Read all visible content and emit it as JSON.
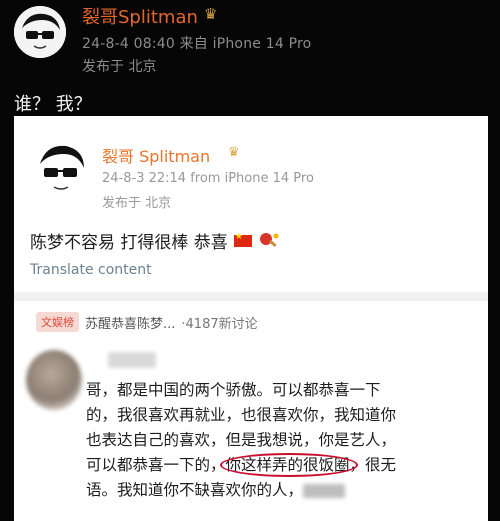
{
  "outer_post": {
    "author": "裂哥Splitman",
    "meta": "24-8-4 08:40  来自 iPhone 14 Pro",
    "location": "发布于 北京",
    "text": "谁？ 我？"
  },
  "quoted_post": {
    "author": "裂哥 Splitman",
    "meta": "24-8-3 22:14  from iPhone 14 Pro",
    "location": "发布于 北京",
    "text": "陈梦不容易 打得很棒 恭喜",
    "translate": "Translate content",
    "icons": [
      "china-flag-icon",
      "ping-pong-icon",
      "crown-icon"
    ]
  },
  "topic": {
    "badge": "文娱榜",
    "title": "苏醒恭喜陈梦...",
    "count": "·4187新讨论"
  },
  "comment": {
    "line1": "哥，都是中国的两个骄傲。可以都恭喜一下",
    "line2": "的，我很喜欢再就业，也很喜欢你，我知道你",
    "line3": "也表达自己的喜欢，但是我想说，你是艺人，",
    "line4_pre": "可以都恭喜一下的，",
    "line4_circled": "你这样弄的很饭圈",
    "line4_post": "，很无",
    "line5": "语。我知道你不缺喜欢你的人，"
  },
  "colors": {
    "author_orange": "#e4672a",
    "annotation_red": "#c8102e",
    "badge_bg": "#f6d9d3"
  }
}
